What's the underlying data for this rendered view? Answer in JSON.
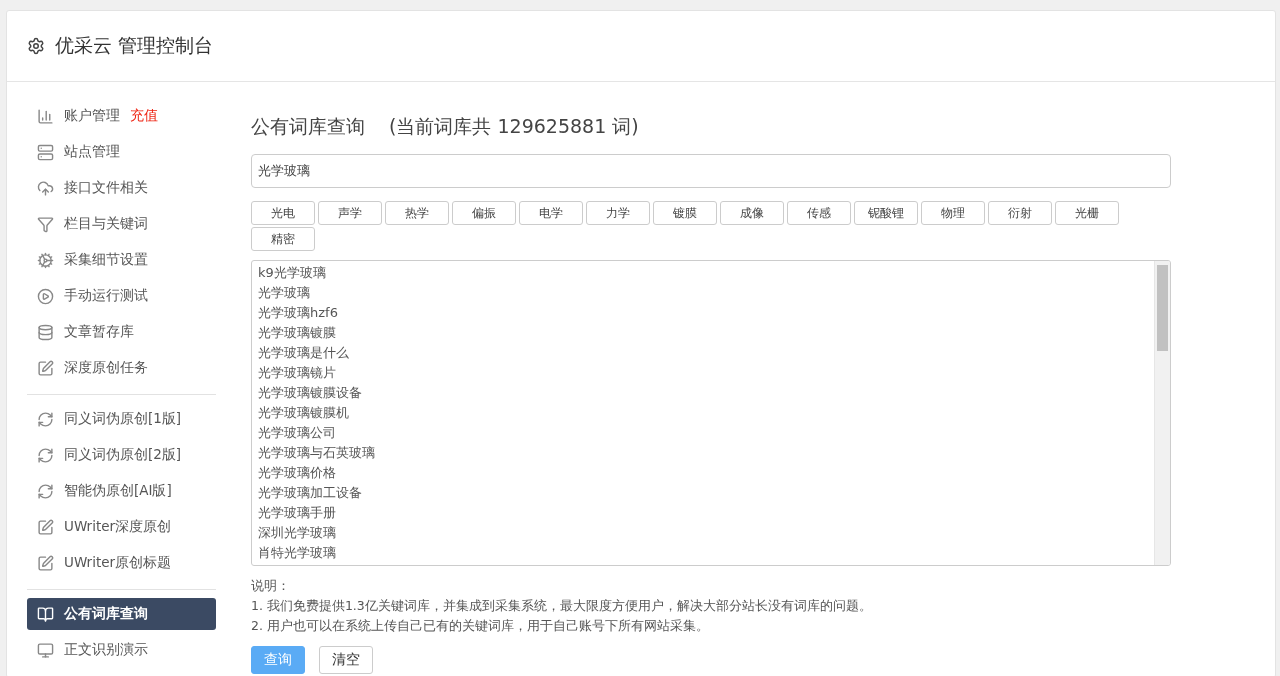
{
  "header": {
    "title": "优采云 管理控制台"
  },
  "sidebar": {
    "groups": [
      [
        {
          "label": "账户管理",
          "badge": "充值",
          "selected": false
        },
        {
          "label": "站点管理",
          "selected": false
        },
        {
          "label": "接口文件相关",
          "selected": false
        },
        {
          "label": "栏目与关键词",
          "selected": false
        },
        {
          "label": "采集细节设置",
          "selected": false
        },
        {
          "label": "手动运行测试",
          "selected": false
        },
        {
          "label": "文章暂存库",
          "selected": false
        },
        {
          "label": "深度原创任务",
          "selected": false
        }
      ],
      [
        {
          "label": "同义词伪原创[1版]",
          "selected": false
        },
        {
          "label": "同义词伪原创[2版]",
          "selected": false
        },
        {
          "label": "智能伪原创[AI版]",
          "selected": false
        },
        {
          "label": "UWriter深度原创",
          "selected": false
        },
        {
          "label": "UWriter原创标题",
          "selected": false
        }
      ],
      [
        {
          "label": "公有词库查询",
          "selected": true
        },
        {
          "label": "正文识别演示",
          "selected": false
        }
      ]
    ]
  },
  "main": {
    "title": "公有词库查询",
    "count_note": "(当前词库共 129625881 词)",
    "search": {
      "value": "光学玻璃"
    },
    "tags": [
      "光电",
      "声学",
      "热学",
      "偏振",
      "电学",
      "力学",
      "镀膜",
      "成像",
      "传感",
      "铌酸锂",
      "物理",
      "衍射",
      "光栅",
      "精密"
    ],
    "results": [
      "k9光学玻璃",
      "光学玻璃",
      "光学玻璃hzf6",
      "光学玻璃镀膜",
      "光学玻璃是什么",
      "光学玻璃镜片",
      "光学玻璃镀膜设备",
      "光学玻璃镀膜机",
      "光学玻璃公司",
      "光学玻璃与石英玻璃",
      "光学玻璃价格",
      "光学玻璃加工设备",
      "光学玻璃手册",
      "深圳光学玻璃",
      "肖特光学玻璃"
    ],
    "notes_title": "说明：",
    "notes": [
      "1. 我们免费提供1.3亿关键词库，并集成到采集系统，最大限度方便用户，解决大部分站长没有词库的问题。",
      "2. 用户也可以在系统上传自己已有的关键词库，用于自己账号下所有网站采集。"
    ],
    "buttons": [
      {
        "label": "查询",
        "kind": "primary"
      },
      {
        "label": "清空",
        "kind": "default"
      }
    ]
  }
}
